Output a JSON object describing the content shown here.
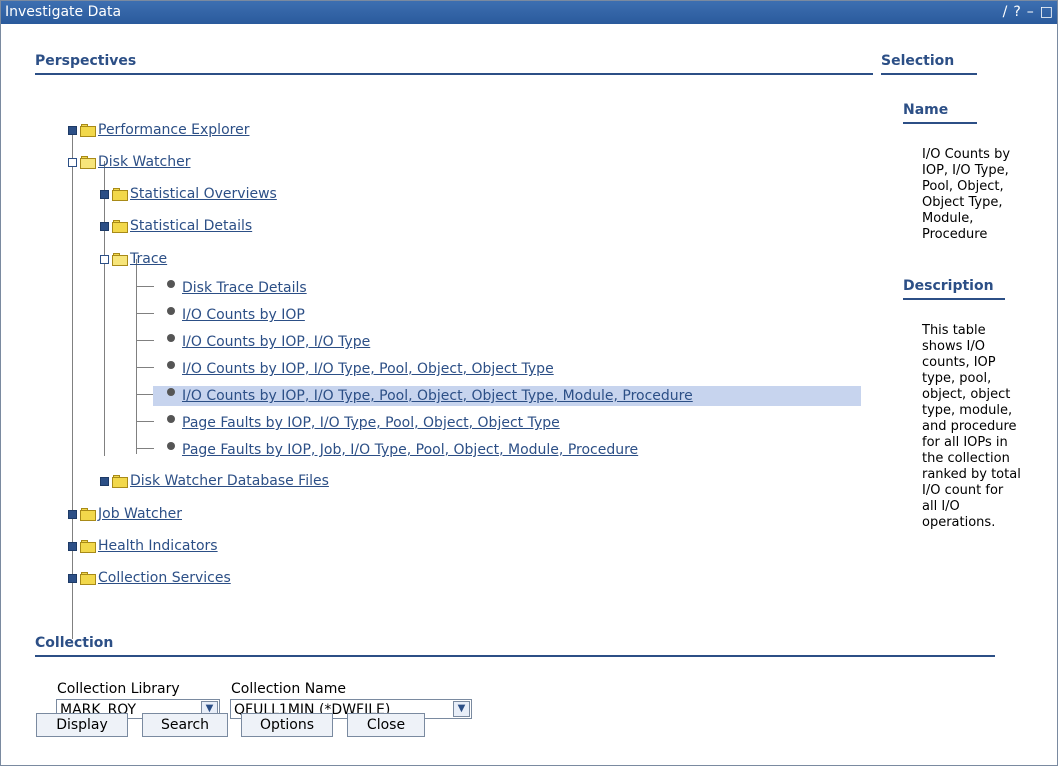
{
  "window": {
    "title": "Investigate Data",
    "controls": [
      "edit-icon",
      "help-icon",
      "minimize-icon",
      "maximize-icon"
    ],
    "control_glyphs": [
      "/",
      "?",
      "–",
      "□"
    ]
  },
  "perspectives": {
    "heading": "Perspectives",
    "tree": {
      "performance_explorer": "Performance Explorer",
      "disk_watcher": "Disk Watcher",
      "statistical_overviews": "Statistical Overviews",
      "statistical_details": "Statistical Details",
      "trace": "Trace",
      "trace_items": [
        "Disk Trace Details",
        "I/O Counts by IOP",
        "I/O Counts by IOP, I/O Type",
        "I/O Counts by IOP, I/O Type, Pool, Object, Object Type",
        "I/O Counts by IOP, I/O Type, Pool, Object, Object Type, Module, Procedure",
        "Page Faults by IOP, I/O Type, Pool, Object, Object Type",
        "Page Faults by IOP, Job, I/O Type, Pool, Object, Module, Procedure"
      ],
      "selected_index": 4,
      "disk_watcher_db_files": "Disk Watcher Database Files",
      "job_watcher": "Job Watcher",
      "health_indicators": "Health Indicators",
      "collection_services": "Collection Services"
    }
  },
  "selection": {
    "heading": "Selection",
    "name_heading": "Name",
    "name_text": "I/O Counts by\nIOP, I/O Type,\nPool, Object,\nObject Type,\nModule,\nProcedure",
    "description_heading": "Description",
    "description_text": "This table\nshows I/O\ncounts, IOP\ntype, pool,\nobject, object\ntype, module,\nand procedure\nfor all IOPs in\nthe collection\nranked by total\nI/O count for\nall I/O\noperations."
  },
  "collection": {
    "heading": "Collection",
    "library_label": "Collection Library",
    "library_value": "MARK_ROY",
    "name_label": "Collection Name",
    "name_value": "QFULL1MIN (*DWFILE)"
  },
  "buttons": {
    "display": "Display",
    "search": "Search",
    "options": "Options",
    "close": "Close"
  },
  "colors": {
    "titlebar": "#2a5a9c",
    "link": "#2c4f86",
    "selection_highlight": "#c7d4ee"
  }
}
